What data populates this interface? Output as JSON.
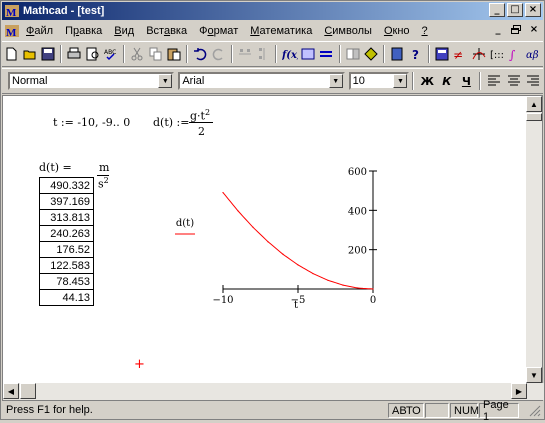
{
  "window": {
    "title": "Mathcad - [test]"
  },
  "menu": {
    "items": [
      "Файл",
      "Правка",
      "Вид",
      "Вставка",
      "Формат",
      "Математика",
      "Символы",
      "Окно",
      "?"
    ],
    "underline_index": [
      0,
      1,
      0,
      3,
      1,
      0,
      0,
      0,
      0
    ]
  },
  "caption_buttons": {
    "minimize": "_",
    "maximize": "□",
    "close": "×"
  },
  "doc_buttons": {
    "minimize": "_",
    "restore": "🗗",
    "close": "×"
  },
  "format_bar": {
    "style_value": "Normal",
    "font_value": "Arial",
    "size_value": "10",
    "bold": "Ж",
    "italic": "К",
    "underline": "Ч"
  },
  "document": {
    "def_t": "t := -10, -9.. 0",
    "def_d_lhs": "d(t) :=",
    "def_d_num_base": "g·t",
    "def_d_num_exp": "2",
    "def_d_den": "2",
    "result_label": "d(t) =",
    "unit_top": "m",
    "unit_bottom_base": "s",
    "unit_bottom_exp": "2",
    "results": [
      "490.332",
      "397.169",
      "313.813",
      "240.263",
      "176.52",
      "122.583",
      "78.453",
      "44.13"
    ],
    "graph_y_label": "d(t)",
    "graph_x_label": "t"
  },
  "chart_data": {
    "type": "line",
    "x": [
      -10,
      -9,
      -8,
      -7,
      -6,
      -5,
      -4,
      -3,
      -2,
      -1,
      0
    ],
    "series": [
      {
        "values": [
          490.332,
          397.169,
          313.813,
          240.263,
          176.52,
          122.583,
          78.453,
          44.13,
          19.613,
          4.903,
          0
        ]
      }
    ],
    "xlabel": "t",
    "ylabel": "d(t)",
    "xlim": [
      -10,
      0
    ],
    "ylim": [
      0,
      600
    ],
    "x_ticks": [
      "−10",
      "−5",
      "0"
    ],
    "y_ticks": [
      "600",
      "400",
      "200"
    ],
    "line_color": "#ff0000"
  },
  "status": {
    "help": "Press F1 for help.",
    "mode": "АВТО",
    "num": "NUM",
    "page": "Page 1"
  },
  "colors": {
    "title_start": "#0a246a",
    "title_end": "#a6caf0",
    "plot_line": "#ff0000"
  }
}
